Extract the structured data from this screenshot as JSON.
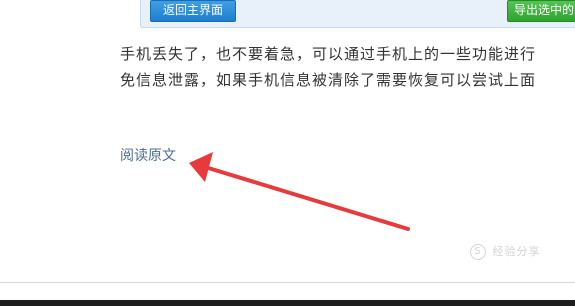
{
  "toolbar": {
    "home_button": "返回主界面",
    "export_button": "导出选中的"
  },
  "article": {
    "line1": "手机丢失了，也不要着急，可以通过手机上的一些功能进行",
    "line2": "免信息泄露，如果手机信息被清除了需要恢复可以尝试上面"
  },
  "links": {
    "read_original": "阅读原文"
  },
  "annotation": {
    "arrow_color": "#e83a3a"
  },
  "watermark": {
    "logo": "S",
    "text": "经验分享"
  }
}
